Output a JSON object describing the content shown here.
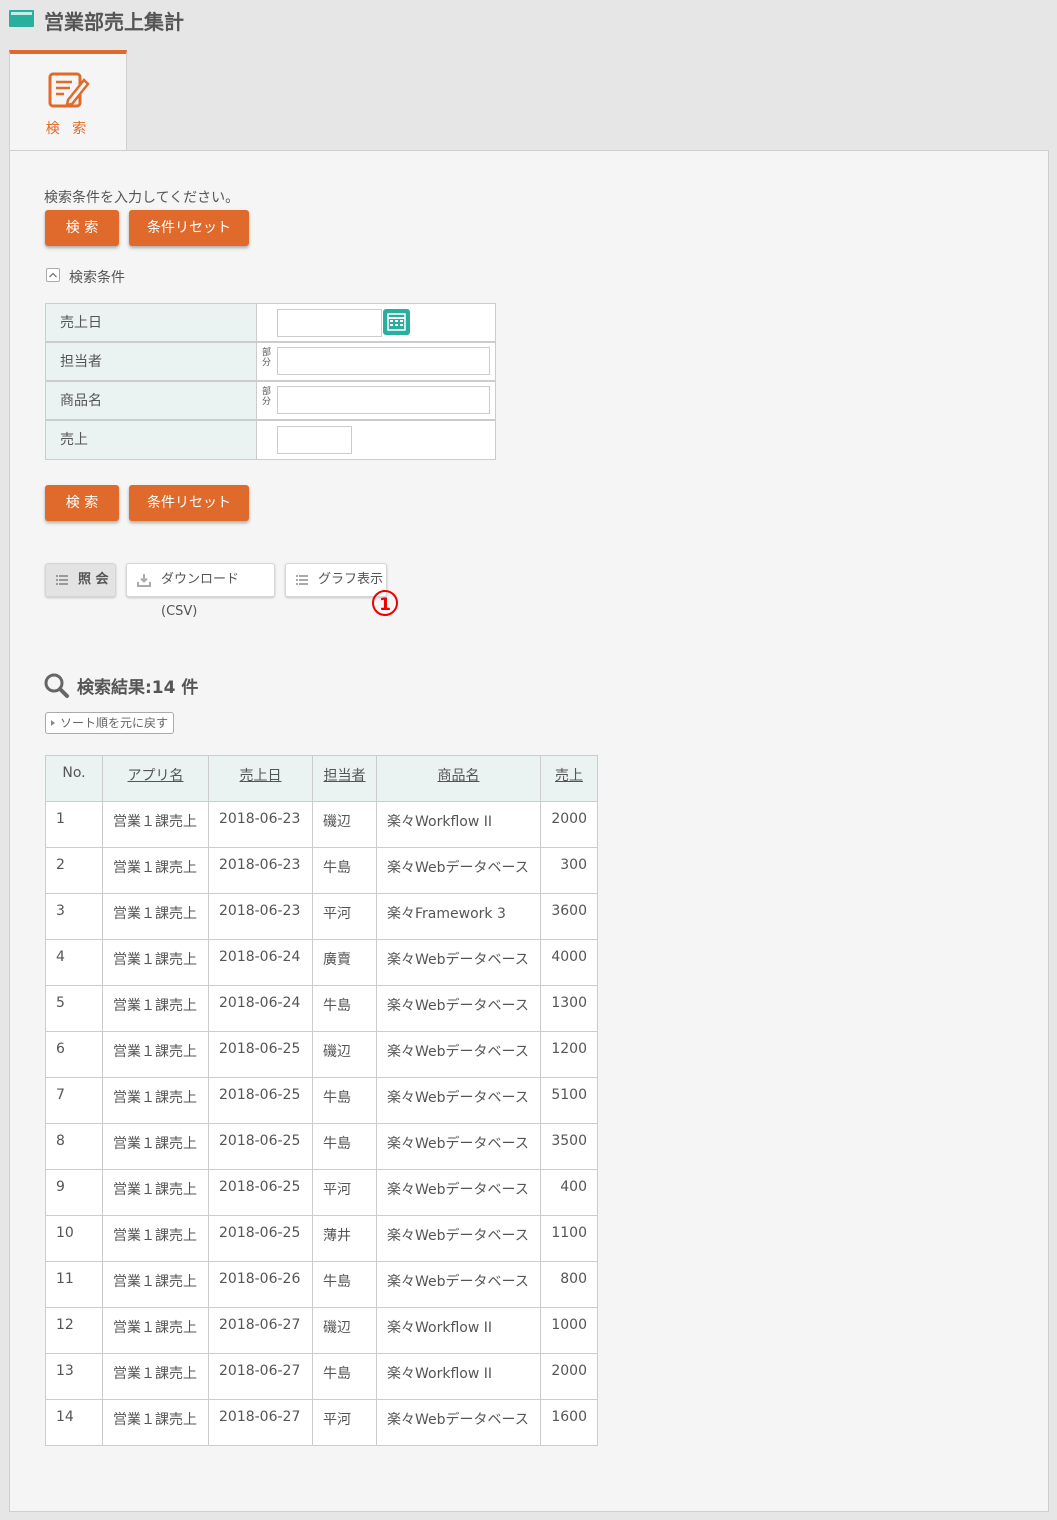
{
  "page": {
    "title": "営業部売上集計"
  },
  "tab": {
    "label": "検 索"
  },
  "search": {
    "hint": "検索条件を入力してください。",
    "search_button": "検 索",
    "reset_button": "条件リセット",
    "conditions_label": "検索条件",
    "fields": {
      "sales_date_label": "売上日",
      "sales_date_value": "",
      "person_label": "担当者",
      "person_value": "",
      "product_label": "商品名",
      "product_value": "",
      "amount_label": "売上",
      "amount_value": "",
      "partial_tag": "部分"
    }
  },
  "actions": {
    "view": "照 会",
    "download": "ダウンロード(CSV)",
    "graph": "グラフ表示",
    "marker": "1"
  },
  "results": {
    "title": "検索結果:14 件",
    "sort_reset": "ソート順を元に戻す",
    "columns": [
      "No.",
      "アプリ名",
      "売上日",
      "担当者",
      "商品名",
      "売上"
    ],
    "rows": [
      [
        "1",
        "営業１課売上",
        "2018-06-23",
        "磯辺",
        "楽々Workflow II",
        "2000"
      ],
      [
        "2",
        "営業１課売上",
        "2018-06-23",
        "牛島",
        "楽々Webデータベース",
        "300"
      ],
      [
        "3",
        "営業１課売上",
        "2018-06-23",
        "平河",
        "楽々Framework 3",
        "3600"
      ],
      [
        "4",
        "営業１課売上",
        "2018-06-24",
        "廣賣",
        "楽々Webデータベース",
        "4000"
      ],
      [
        "5",
        "営業１課売上",
        "2018-06-24",
        "牛島",
        "楽々Webデータベース",
        "1300"
      ],
      [
        "6",
        "営業１課売上",
        "2018-06-25",
        "磯辺",
        "楽々Webデータベース",
        "1200"
      ],
      [
        "7",
        "営業１課売上",
        "2018-06-25",
        "牛島",
        "楽々Webデータベース",
        "5100"
      ],
      [
        "8",
        "営業１課売上",
        "2018-06-25",
        "牛島",
        "楽々Webデータベース",
        "3500"
      ],
      [
        "9",
        "営業１課売上",
        "2018-06-25",
        "平河",
        "楽々Webデータベース",
        "400"
      ],
      [
        "10",
        "営業１課売上",
        "2018-06-25",
        "薄井",
        "楽々Webデータベース",
        "1100"
      ],
      [
        "11",
        "営業１課売上",
        "2018-06-26",
        "牛島",
        "楽々Webデータベース",
        "800"
      ],
      [
        "12",
        "営業１課売上",
        "2018-06-27",
        "磯辺",
        "楽々Workflow II",
        "1000"
      ],
      [
        "13",
        "営業１課売上",
        "2018-06-27",
        "牛島",
        "楽々Workflow II",
        "2000"
      ],
      [
        "14",
        "営業１課売上",
        "2018-06-27",
        "平河",
        "楽々Webデータベース",
        "1600"
      ]
    ]
  },
  "colors": {
    "accent": "#e06a2b",
    "teal": "#2aaf9f",
    "label_bg": "#eaf2f2"
  }
}
